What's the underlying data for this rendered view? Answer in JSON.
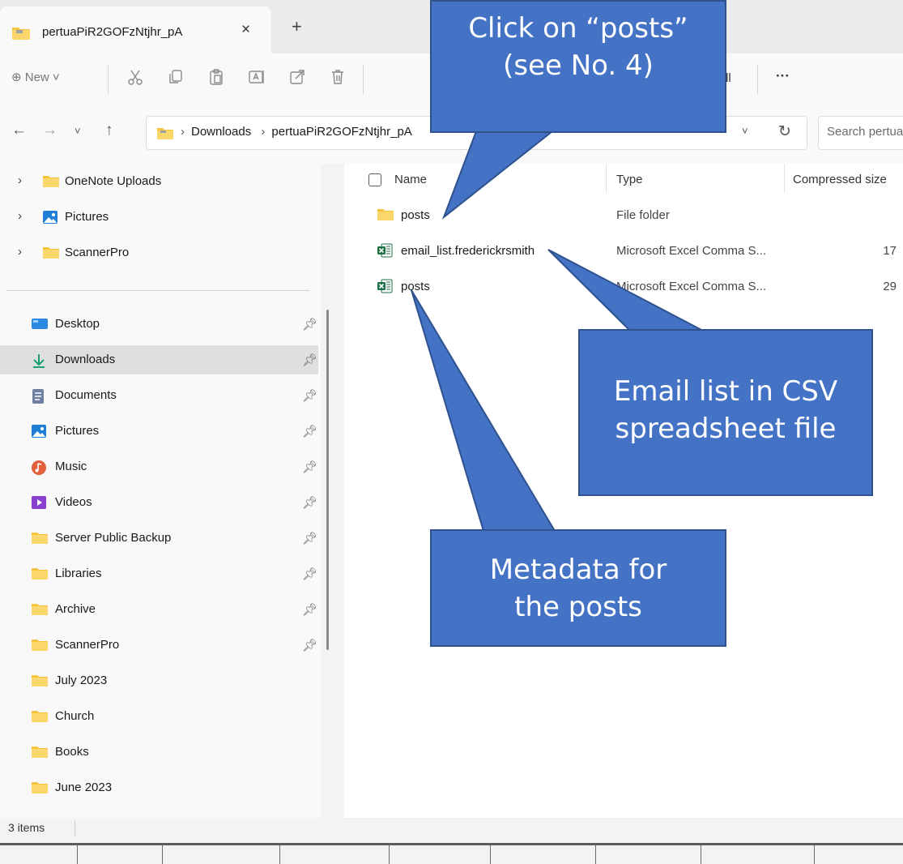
{
  "window": {
    "tab_title": "pertuaPiR2GOFzNtjhr_pA",
    "tab_close_icon": "×",
    "new_tab_icon": "+"
  },
  "toolbar": {
    "new_label": "⊕ New ˅",
    "overflow_label": "···",
    "partial_label": "ll"
  },
  "address": {
    "crumbs": [
      "Downloads",
      "pertuaPiR2GOFzNtjhr_pA"
    ],
    "search_placeholder": "Search pertua"
  },
  "sidebar": {
    "tree": [
      {
        "label": "OneNote Uploads",
        "icon": "folder-icon"
      },
      {
        "label": "Pictures",
        "icon": "pictures-icon"
      },
      {
        "label": "ScannerPro",
        "icon": "folder-icon"
      }
    ],
    "quick_access": [
      {
        "label": "Desktop",
        "icon": "desktop-icon",
        "pinned": true,
        "selected": false
      },
      {
        "label": "Downloads",
        "icon": "download-icon",
        "pinned": true,
        "selected": true
      },
      {
        "label": "Documents",
        "icon": "documents-icon",
        "pinned": true,
        "selected": false
      },
      {
        "label": "Pictures",
        "icon": "pictures-icon",
        "pinned": true,
        "selected": false
      },
      {
        "label": "Music",
        "icon": "music-icon",
        "pinned": true,
        "selected": false
      },
      {
        "label": "Videos",
        "icon": "videos-icon",
        "pinned": true,
        "selected": false
      },
      {
        "label": "Server Public Backup",
        "icon": "folder-icon",
        "pinned": true,
        "selected": false
      },
      {
        "label": "Libraries",
        "icon": "folder-icon",
        "pinned": true,
        "selected": false
      },
      {
        "label": "Archive",
        "icon": "folder-icon",
        "pinned": true,
        "selected": false
      },
      {
        "label": "ScannerPro",
        "icon": "folder-icon",
        "pinned": true,
        "selected": false
      },
      {
        "label": "July 2023",
        "icon": "folder-icon",
        "pinned": false,
        "selected": false
      },
      {
        "label": "Church",
        "icon": "folder-icon",
        "pinned": false,
        "selected": false
      },
      {
        "label": "Books",
        "icon": "folder-icon",
        "pinned": false,
        "selected": false
      },
      {
        "label": "June 2023",
        "icon": "folder-icon",
        "pinned": false,
        "selected": false
      }
    ]
  },
  "files": {
    "columns": {
      "name": "Name",
      "type": "Type",
      "compressed_size": "Compressed size"
    },
    "rows": [
      {
        "name": "posts",
        "type": "File folder",
        "size": "",
        "icon": "folder-icon"
      },
      {
        "name": "email_list.frederickrsmith",
        "type": "Microsoft Excel Comma S...",
        "size": "17",
        "icon": "excel-csv-icon"
      },
      {
        "name": "posts",
        "type": "Microsoft Excel Comma S...",
        "size": "29",
        "icon": "excel-csv-icon"
      }
    ]
  },
  "status": {
    "item_count": "3 items"
  },
  "callouts": [
    {
      "line1": "Click on “posts”",
      "line2": "(see No. 4)"
    },
    {
      "line1": "Email list in CSV",
      "line2": "spreadsheet file"
    },
    {
      "line1": "Metadata for",
      "line2": "the posts"
    }
  ],
  "colors": {
    "callout": "#4472c4",
    "folder": "#f4c43c",
    "excel": "#1d7044"
  }
}
